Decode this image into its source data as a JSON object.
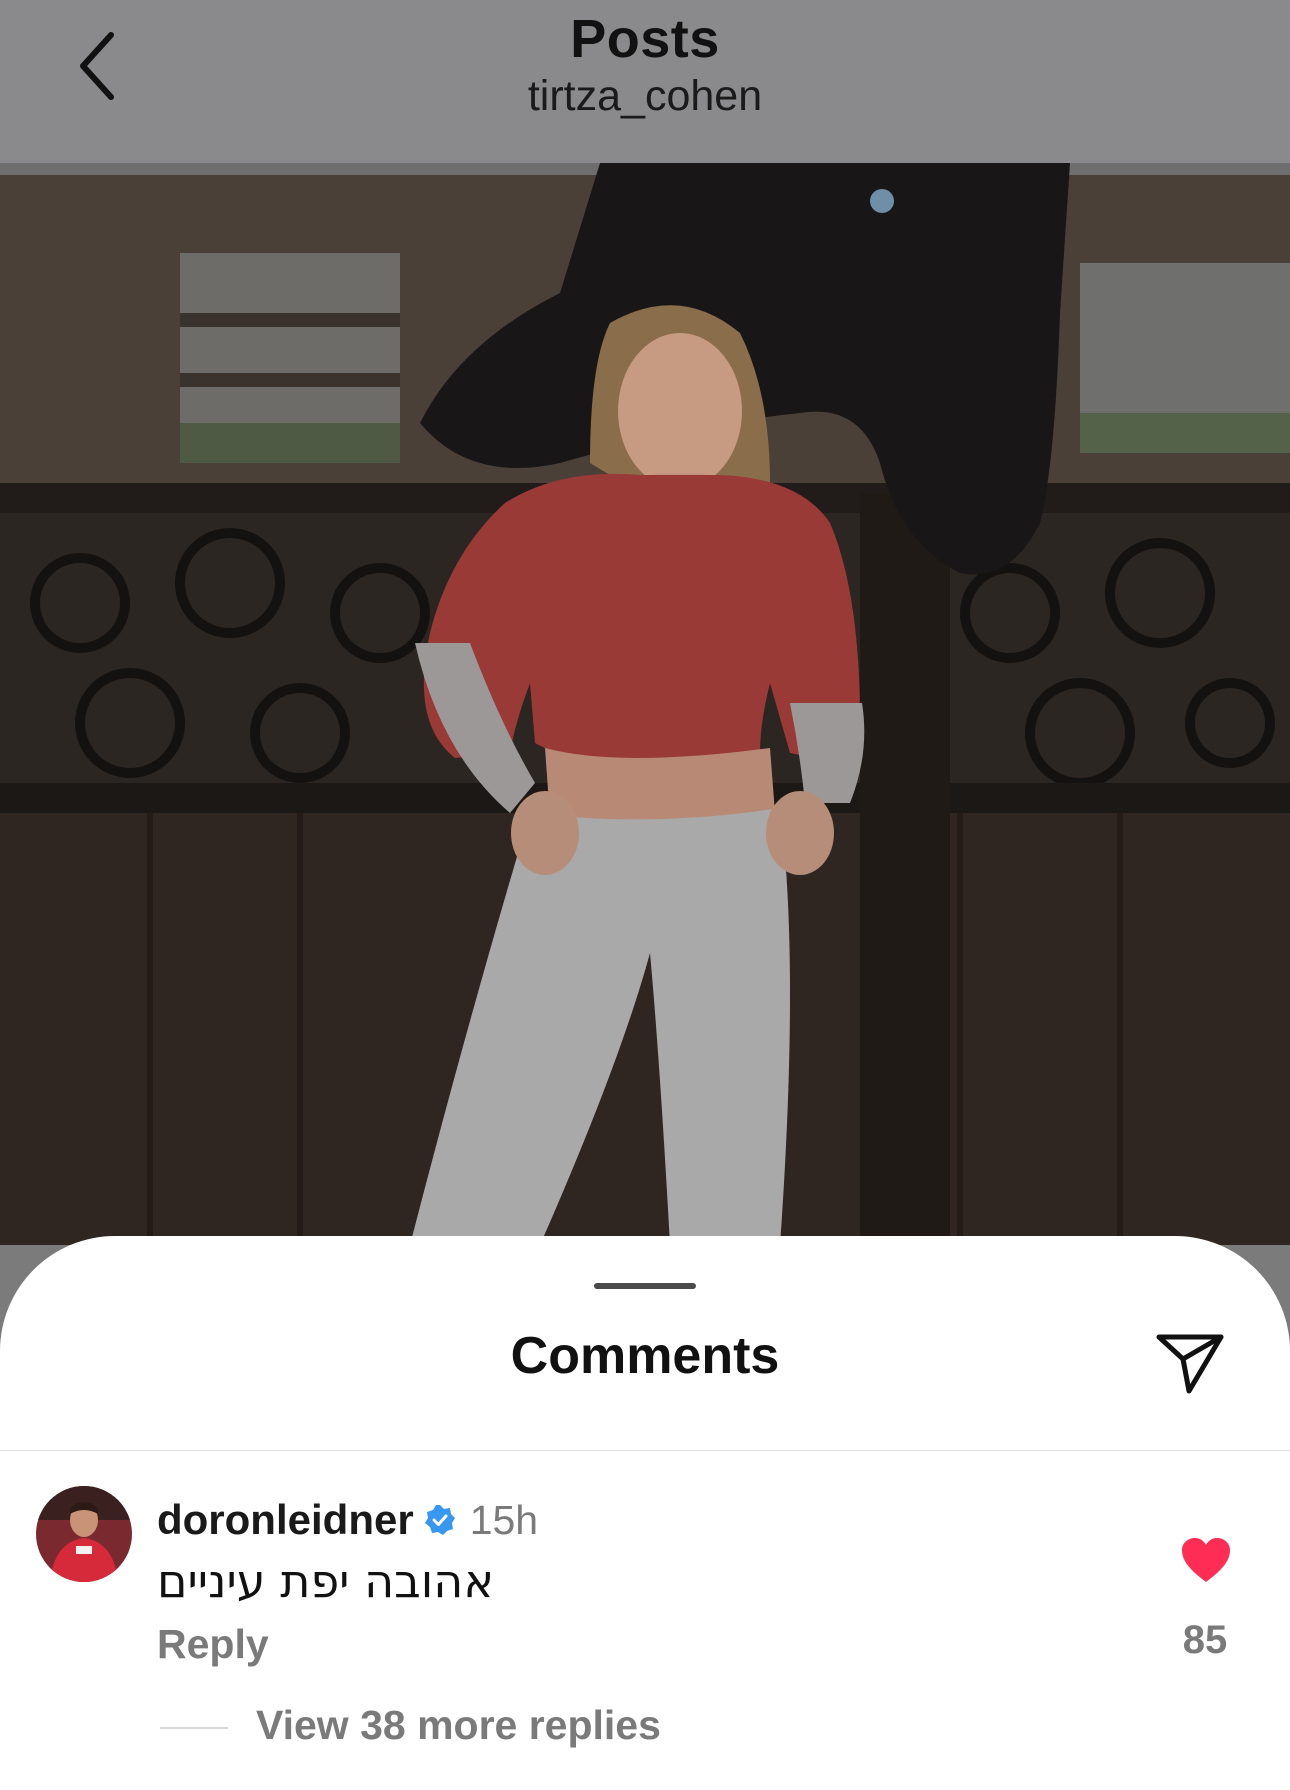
{
  "header": {
    "title": "Posts",
    "username": "tirtza_cohen"
  },
  "post": {
    "image_icon": "post-photo"
  },
  "comments_sheet": {
    "title": "Comments",
    "share_icon": "send-icon",
    "comments": [
      {
        "username": "doronleidner",
        "verified": true,
        "time": "15h",
        "text": "אהובה יפת עיניים",
        "reply_label": "Reply",
        "liked": true,
        "like_count": "85",
        "view_replies_label": "View 38 more replies"
      }
    ]
  },
  "colors": {
    "like_red": "#ff2d55",
    "verified_blue": "#3897f0",
    "muted_text": "#7a7a7a"
  }
}
